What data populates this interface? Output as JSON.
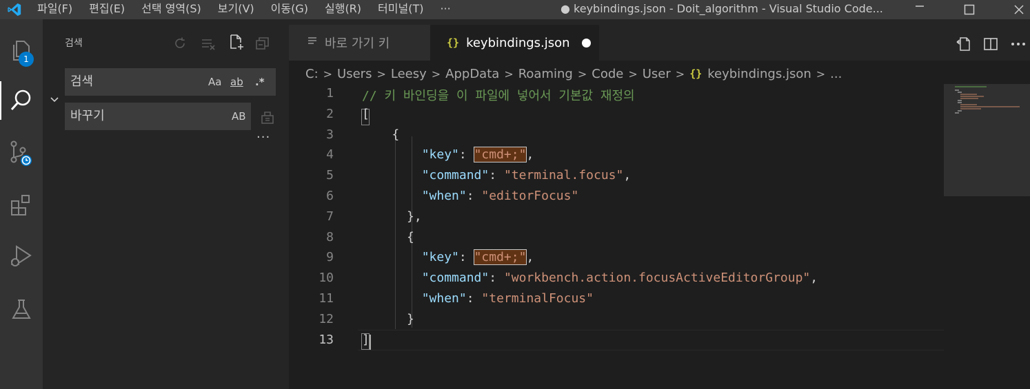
{
  "titlebar": {
    "menu": [
      "파일(F)",
      "편집(E)",
      "선택 영역(S)",
      "보기(V)",
      "이동(G)",
      "실행(R)",
      "터미널(T)",
      "···"
    ],
    "window_title": "● keybindings.json - Doit_algorithm - Visual Studio Code..."
  },
  "activitybar": {
    "explorer_badge": "1"
  },
  "sidebar": {
    "title": "검색",
    "search": {
      "value": "검색",
      "options": [
        "Aa",
        "ab",
        ".*"
      ]
    },
    "replace": {
      "value": "바꾸기",
      "option": "AB"
    },
    "more": "···"
  },
  "tabs": [
    {
      "label": "바로 가기 키",
      "active": false
    },
    {
      "label": "keybindings.json",
      "active": true,
      "icon": "{}"
    }
  ],
  "breadcrumb": [
    "C:",
    "Users",
    "Leesy",
    "AppData",
    "Roaming",
    "Code",
    "User",
    "keybindings.json",
    "..."
  ],
  "editor": {
    "current_line": 13,
    "line_numbers": [
      "1",
      "2",
      "3",
      "4",
      "5",
      "6",
      "7",
      "8",
      "9",
      "10",
      "11",
      "12",
      "13"
    ],
    "lines": [
      [
        {
          "t": "// 키 바인딩을 이 파일에 넣어서 기본값 재정의",
          "c": "comment"
        }
      ],
      [
        {
          "t": "[",
          "c": "punc"
        }
      ],
      [
        {
          "t": "    {",
          "c": "punc"
        }
      ],
      [
        {
          "t": "        ",
          "c": "punc"
        },
        {
          "t": "\"key\"",
          "c": "key"
        },
        {
          "t": ": ",
          "c": "punc"
        },
        {
          "t": "\"cmd+;\"",
          "c": "str",
          "hl": true
        },
        {
          "t": ",",
          "c": "punc"
        }
      ],
      [
        {
          "t": "        ",
          "c": "punc"
        },
        {
          "t": "\"command\"",
          "c": "key"
        },
        {
          "t": ": ",
          "c": "punc"
        },
        {
          "t": "\"terminal.focus\"",
          "c": "str"
        },
        {
          "t": ",",
          "c": "punc"
        }
      ],
      [
        {
          "t": "        ",
          "c": "punc"
        },
        {
          "t": "\"when\"",
          "c": "key"
        },
        {
          "t": ": ",
          "c": "punc"
        },
        {
          "t": "\"editorFocus\"",
          "c": "str"
        }
      ],
      [
        {
          "t": "      },",
          "c": "punc"
        }
      ],
      [
        {
          "t": "      {",
          "c": "punc"
        }
      ],
      [
        {
          "t": "        ",
          "c": "punc"
        },
        {
          "t": "\"key\"",
          "c": "key"
        },
        {
          "t": ": ",
          "c": "punc"
        },
        {
          "t": "\"cmd+;\"",
          "c": "str",
          "hl": true
        },
        {
          "t": ",",
          "c": "punc"
        }
      ],
      [
        {
          "t": "        ",
          "c": "punc"
        },
        {
          "t": "\"command\"",
          "c": "key"
        },
        {
          "t": ": ",
          "c": "punc"
        },
        {
          "t": "\"workbench.action.focusActiveEditorGroup\"",
          "c": "str"
        },
        {
          "t": ",",
          "c": "punc"
        }
      ],
      [
        {
          "t": "        ",
          "c": "punc"
        },
        {
          "t": "\"when\"",
          "c": "key"
        },
        {
          "t": ": ",
          "c": "punc"
        },
        {
          "t": "\"terminalFocus\"",
          "c": "str"
        }
      ],
      [
        {
          "t": "      }",
          "c": "punc"
        }
      ],
      [
        {
          "t": "]",
          "c": "punc"
        }
      ]
    ]
  },
  "colors": {
    "accent": "#007acc",
    "comment": "#6a9955",
    "json_key": "#9cdcfe",
    "json_string": "#ce9178",
    "json_icon": "#cbcb41"
  }
}
